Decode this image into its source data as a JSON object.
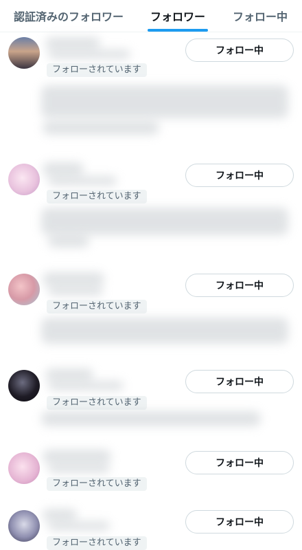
{
  "tabs": [
    {
      "label": "認証済みのフォロワー"
    },
    {
      "label": "フォロワー"
    },
    {
      "label": "フォロー中"
    }
  ],
  "followers": [
    {
      "badge": "フォローされています",
      "button": "フォロー中"
    },
    {
      "badge": "フォローされています",
      "button": "フォロー中"
    },
    {
      "badge": "フォローされています",
      "button": "フォロー中"
    },
    {
      "badge": "フォローされています",
      "button": "フォロー中"
    },
    {
      "badge": "フォローされています",
      "button": "フォロー中"
    },
    {
      "badge": "フォローされています",
      "button": "フォロー中"
    }
  ],
  "colors": {
    "accent": "#1d9bf0",
    "text": "#0f1419",
    "secondary": "#536471",
    "border": "#cfd9de"
  }
}
